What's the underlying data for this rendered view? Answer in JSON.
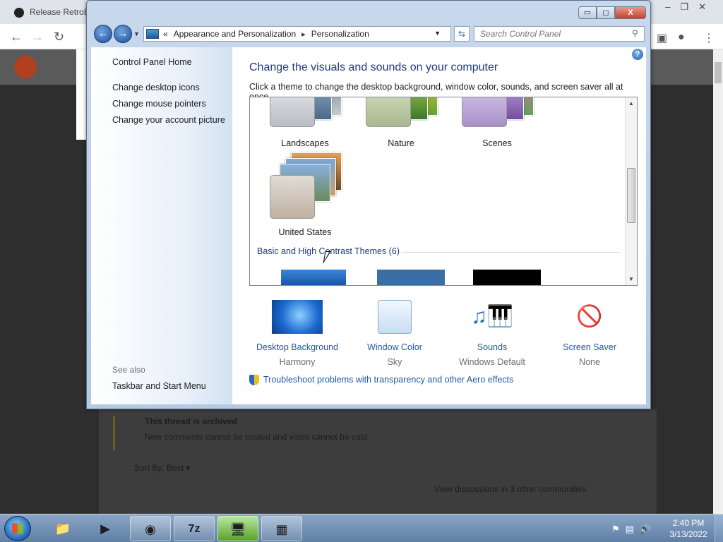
{
  "browser": {
    "tab_title": "Release RetroB"
  },
  "background_page": {
    "archived_title": "This thread is archived",
    "archived_text": "New comments cannot be posted and votes cannot be cast",
    "sort_label": "Sort By: Best",
    "view_discussions": "View discussions in 3 other communities"
  },
  "window": {
    "buttons": {
      "minimize": "▭",
      "maximize": "◻",
      "close": "X"
    },
    "address": {
      "overflow": "«",
      "crumbs": [
        "Appearance and Personalization",
        "Personalization"
      ]
    },
    "search_placeholder": "Search Control Panel"
  },
  "sidebar": {
    "home": "Control Panel Home",
    "links": [
      "Change desktop icons",
      "Change mouse pointers",
      "Change your account picture"
    ],
    "see_also_label": "See also",
    "see_also_links": [
      "Taskbar and Start Menu"
    ]
  },
  "main": {
    "title": "Change the visuals and sounds on your computer",
    "subtitle": "Click a theme to change the desktop background, window color, sounds, and screen saver all at once.",
    "themes": [
      "Landscapes",
      "Nature",
      "Scenes",
      "United States"
    ],
    "group_heading": "Basic and High Contrast Themes (6)",
    "settings": [
      {
        "label": "Desktop Background",
        "value": "Harmony"
      },
      {
        "label": "Window Color",
        "value": "Sky"
      },
      {
        "label": "Sounds",
        "value": "Windows Default"
      },
      {
        "label": "Screen Saver",
        "value": "None"
      }
    ],
    "troubleshoot": "Troubleshoot problems with transparency and other Aero effects"
  },
  "taskbar": {
    "time": "2:40 PM",
    "date": "3/13/2022",
    "apps": [
      "file-explorer",
      "media-player",
      "chrome",
      "7-zip",
      "remote-desktop",
      "control-panel"
    ]
  },
  "colors": {
    "link": "#1e5aa6",
    "heading": "#1e3a7e",
    "accent": "#2b6fc0"
  }
}
